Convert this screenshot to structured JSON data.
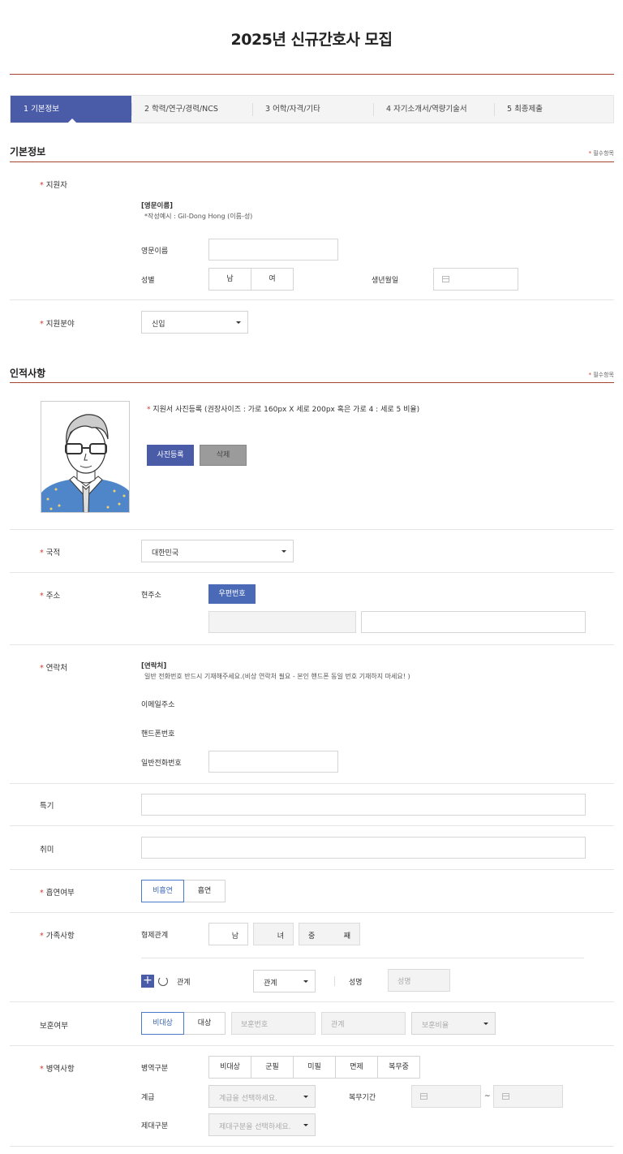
{
  "page": {
    "title": "2025년 신규간호사 모집"
  },
  "steps": [
    {
      "label": "1  기본정보",
      "active": true
    },
    {
      "label": "2  학력/연구/경력/NCS"
    },
    {
      "label": "3  어학/자격/기타"
    },
    {
      "label": "4  자기소개서/역량기술서"
    },
    {
      "label": "5  최종제출"
    }
  ],
  "required_note": "필수항목",
  "required_mark": "*",
  "basic": {
    "section_title": "기본정보",
    "applicant_label": "지원자",
    "eng_name_heading": "[영문이름]",
    "eng_name_example": "*작성예시 : Gil-Dong Hong (이름-성)",
    "eng_name_label": "영문이름",
    "gender_label": "성별",
    "gender_options": [
      "남",
      "여"
    ],
    "birth_label": "생년월일",
    "field_label": "지원분야",
    "field_value": "신입"
  },
  "personal": {
    "section_title": "인적사항",
    "photo_note": "지원서 사진등록 (권장사이즈 : 가로 160px X 세로 200px 혹은 가로 4 : 세로 5 비율)",
    "photo_register_btn": "사진등록",
    "photo_delete_btn": "삭제",
    "nationality_label": "국적",
    "nationality_value": "대한민국",
    "address_label": "주소",
    "current_address_label": "현주소",
    "postcode_btn": "우편번호",
    "contact_label": "연락처",
    "contact_heading": "[연락처]",
    "contact_note": "일반 전화번호 반드시 기재해주세요.(비상 연락처 필요 - 본인 핸드폰 동일 번호 기재하지 마세요! )",
    "email_label": "이메일주소",
    "mobile_label": "핸드폰번호",
    "phone_label": "일반전화번호",
    "skill_label": "특기",
    "hobby_label": "취미",
    "smoking_label": "흡연여부",
    "smoking_options": [
      "비흡연",
      "흡연"
    ],
    "family_label": "가족사항",
    "sibling_label": "형제관계",
    "sibling_male": "남",
    "sibling_female": "녀",
    "sibling_order_prefix": "중",
    "sibling_order_suffix": "째",
    "relation_label": "관계",
    "relation_select": "관계",
    "name_label": "성명",
    "name_placeholder": "성명",
    "veteran_label": "보훈여부",
    "veteran_options": [
      "비대상",
      "대상"
    ],
    "veteran_no_placeholder": "보훈번호",
    "veteran_relation_placeholder": "관계",
    "veteran_ratio_placeholder": "보훈비율",
    "military_label": "병역사항",
    "military_type_label": "병역구분",
    "military_options": [
      "비대상",
      "군필",
      "미필",
      "면제",
      "복무중"
    ],
    "rank_label": "계급",
    "rank_placeholder": "계급을 선택하세요.",
    "service_period_label": "복무기간",
    "service_sep": "~",
    "discharge_label": "제대구분",
    "discharge_placeholder": "제대구분을 선택하세요."
  }
}
